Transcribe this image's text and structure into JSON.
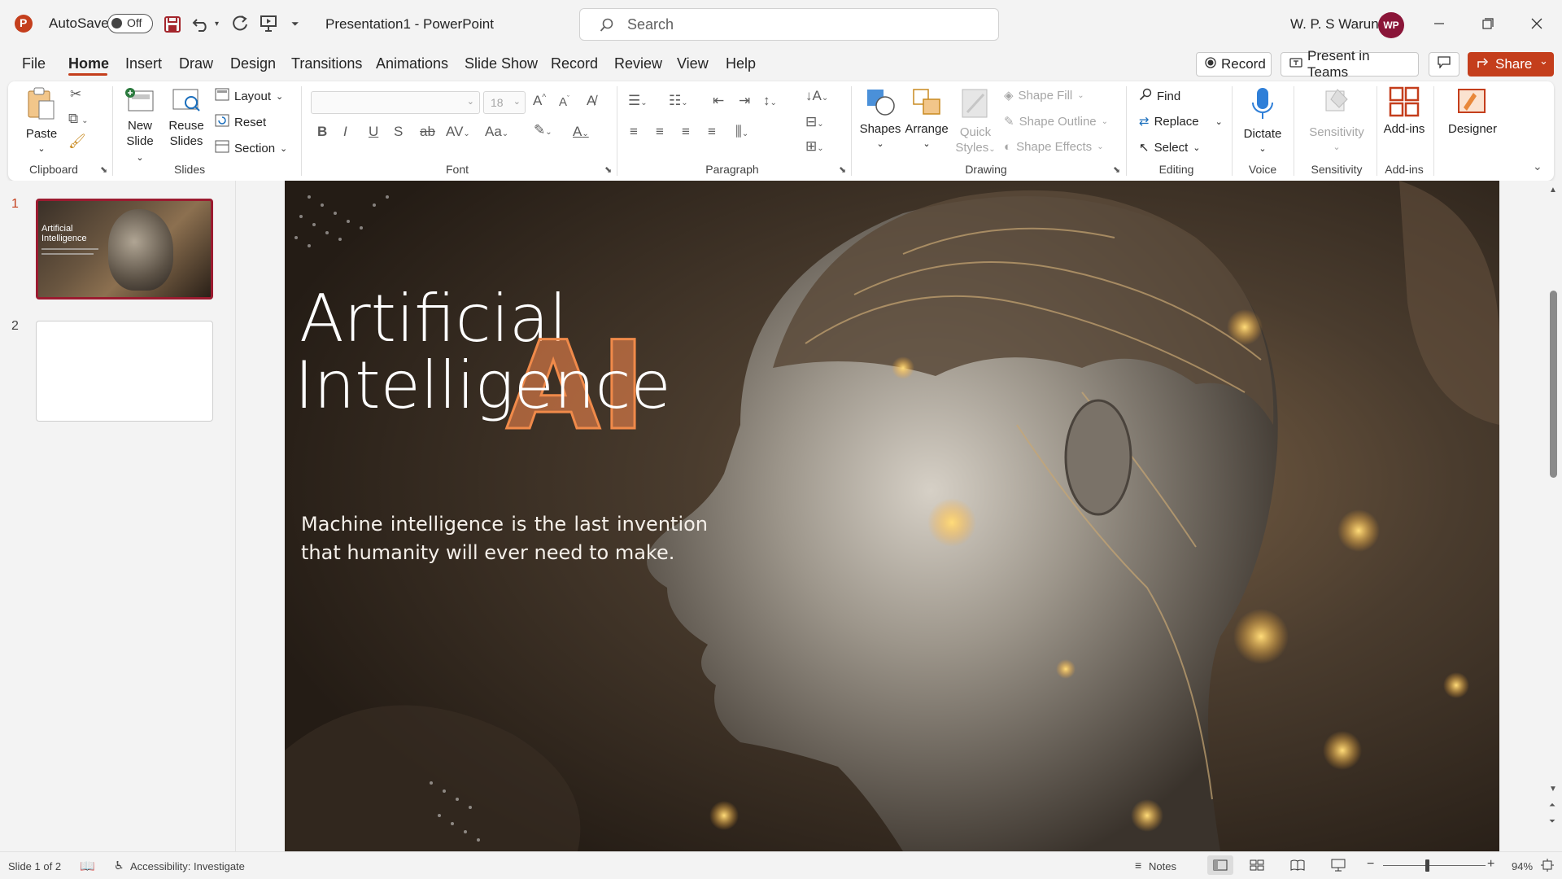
{
  "titlebar": {
    "autosave_label": "AutoSave",
    "autosave_state": "Off",
    "document_title": "Presentation1  -  PowerPoint",
    "search_placeholder": "Search",
    "user_name": "W. P. S Waruna",
    "user_initials": "WP",
    "accent": "#c43e1c"
  },
  "tabs": [
    "File",
    "Home",
    "Insert",
    "Draw",
    "Design",
    "Transitions",
    "Animations",
    "Slide Show",
    "Record",
    "Review",
    "View",
    "Help"
  ],
  "active_tab": "Home",
  "header_buttons": {
    "record": "Record",
    "present_in_teams": "Present in Teams",
    "share": "Share"
  },
  "ribbon": {
    "clipboard": {
      "label": "Clipboard",
      "paste": "Paste"
    },
    "slides": {
      "label": "Slides",
      "new_slide_1": "New",
      "new_slide_2": "Slide",
      "reuse_1": "Reuse",
      "reuse_2": "Slides",
      "layout": "Layout",
      "reset": "Reset",
      "section": "Section"
    },
    "font": {
      "label": "Font",
      "font_size": "18"
    },
    "paragraph": {
      "label": "Paragraph"
    },
    "drawing": {
      "label": "Drawing",
      "shapes": "Shapes",
      "arrange": "Arrange",
      "quick_styles_1": "Quick",
      "quick_styles_2": "Styles",
      "shape_fill": "Shape Fill",
      "shape_outline": "Shape Outline",
      "shape_effects": "Shape Effects"
    },
    "editing": {
      "label": "Editing",
      "find": "Find",
      "replace": "Replace",
      "select": "Select"
    },
    "voice": {
      "label": "Voice",
      "dictate": "Dictate"
    },
    "sensitivity": {
      "label": "Sensitivity",
      "button": "Sensitivity"
    },
    "addins": {
      "label": "Add-ins",
      "button": "Add-ins"
    },
    "designer": {
      "button": "Designer"
    }
  },
  "thumbnails": [
    {
      "number": "1",
      "title_1": "Artificial",
      "title_2": "Intelligence"
    },
    {
      "number": "2"
    }
  ],
  "slide": {
    "title_line1": "Artificial",
    "title_line2": "Intelligence",
    "ai_letters": "AI",
    "subtitle": "Machine intelligence is the last invention that humanity will ever need to make."
  },
  "status": {
    "slide_info": "Slide 1 of 2",
    "accessibility": "Accessibility: Investigate",
    "notes": "Notes",
    "zoom": "94%"
  }
}
